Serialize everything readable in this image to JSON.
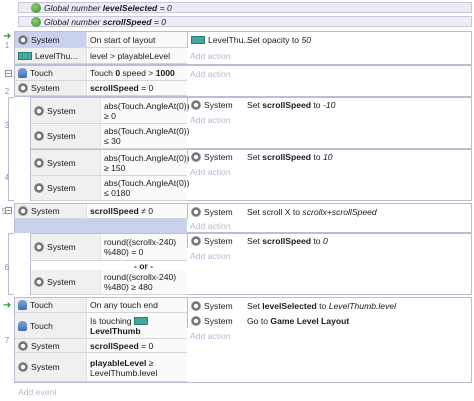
{
  "globals": [
    {
      "prefix": "Global number",
      "name": "levelSelected",
      "value": "= 0"
    },
    {
      "prefix": "Global number",
      "name": "scrollSpeed",
      "value": "= 0"
    }
  ],
  "add_action": "Add action",
  "add_event": "Add event",
  "events": {
    "e1": {
      "num": "1",
      "c1_obj": "System",
      "c1_txt": "On start of layout",
      "c2_obj": "LevelThu...",
      "c2_txt": "level > playableLevel",
      "a1_obj": "LevelThu...",
      "a1_txt": "Set opacity to",
      "a1_val": "50"
    },
    "e2": {
      "num": "2",
      "c1_obj": "Touch",
      "c1_txt_pre": "Touch",
      "c1_txt_b": "0",
      "c1_txt_mid": "speed >",
      "c1_txt_b2": "1000",
      "c2_obj": "System",
      "c2_txt_b": "scrollSpeed",
      "c2_txt": "= 0"
    },
    "e3": {
      "num": "3",
      "c1_obj": "System",
      "c1_txt": "abs(Touch.AngleAt(0)) ≥ 0",
      "c2_obj": "System",
      "c2_txt": "abs(Touch.AngleAt(0)) ≤ 30",
      "a1_obj": "System",
      "a1_txt": "Set",
      "a1_b": "scrollSpeed",
      "a1_mid": "to",
      "a1_val": "-10"
    },
    "e4": {
      "num": "4",
      "c1_obj": "System",
      "c1_txt": "abs(Touch.AngleAt(0)) ≥ 150",
      "c2_obj": "System",
      "c2_txt": "abs(Touch.AngleAt(0)) ≤ 0180",
      "a1_obj": "System",
      "a1_txt": "Set",
      "a1_b": "scrollSpeed",
      "a1_mid": "to",
      "a1_val": "10"
    },
    "e5": {
      "num": "5",
      "c1_obj": "System",
      "c1_txt_b": "scrollSpeed",
      "c1_txt": "≠ 0",
      "a1_obj": "System",
      "a1_txt": "Set scroll X to",
      "a1_val": "scrollx+scrollSpeed"
    },
    "e6": {
      "num": "6",
      "c1_obj": "System",
      "c1_txt": "round((scrollx-240) %480) = 0",
      "or_label": "- or -",
      "c2_obj": "System",
      "c2_txt": "round((scrollx-240) %480) ≥ 480",
      "a1_obj": "System",
      "a1_txt": "Set",
      "a1_b": "scrollSpeed",
      "a1_mid": "to",
      "a1_val": "0"
    },
    "e7": {
      "num": "7",
      "c1_obj": "Touch",
      "c1_txt": "On any touch end",
      "c2_obj": "Touch",
      "c2_txt": "Is touching",
      "c2_b": "LevelThumb",
      "c3_obj": "System",
      "c3_txt_b": "scrollSpeed",
      "c3_txt": "= 0",
      "c4_obj": "System",
      "c4_txt_b": "playableLevel",
      "c4_txt": "≥ LevelThumb.level",
      "a1_obj": "System",
      "a1_txt": "Set",
      "a1_b": "levelSelected",
      "a1_mid": "to",
      "a1_val": "LevelThumb.level",
      "a2_obj": "System",
      "a2_txt": "Go to",
      "a2_b": "Game Level Layout"
    }
  },
  "colors": {
    "selected": "#c9d1ec",
    "border": "#b8bed4",
    "add_text": "#b7bad0",
    "sprite": "#43a7a0"
  }
}
